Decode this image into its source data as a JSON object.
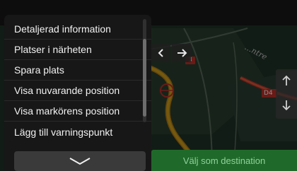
{
  "menu": {
    "items": [
      "Detaljerad information",
      "Platser i närheten",
      "Spara plats",
      "Visa nuvarande position",
      "Visa markörens position",
      "Lägg till varningspunkt"
    ],
    "scroll_fraction": 0.25
  },
  "map": {
    "street_label": "...ntre",
    "road_number_1": "3",
    "road_number_2": "D4"
  },
  "actions": {
    "destination_label": "Välj som destination"
  },
  "icons": {
    "nav_left": "arrow-left-icon",
    "nav_right": "arrow-right-icon",
    "zoom_in": "arrow-up-icon",
    "zoom_out": "arrow-down-icon",
    "more": "chevron-down-icon",
    "cursor": "cursor-marker-icon"
  },
  "colors": {
    "menu_bg": "#171717",
    "destination_bg": "#1f6a2a",
    "route": "#d6a21b",
    "road_red": "#c0322b"
  }
}
